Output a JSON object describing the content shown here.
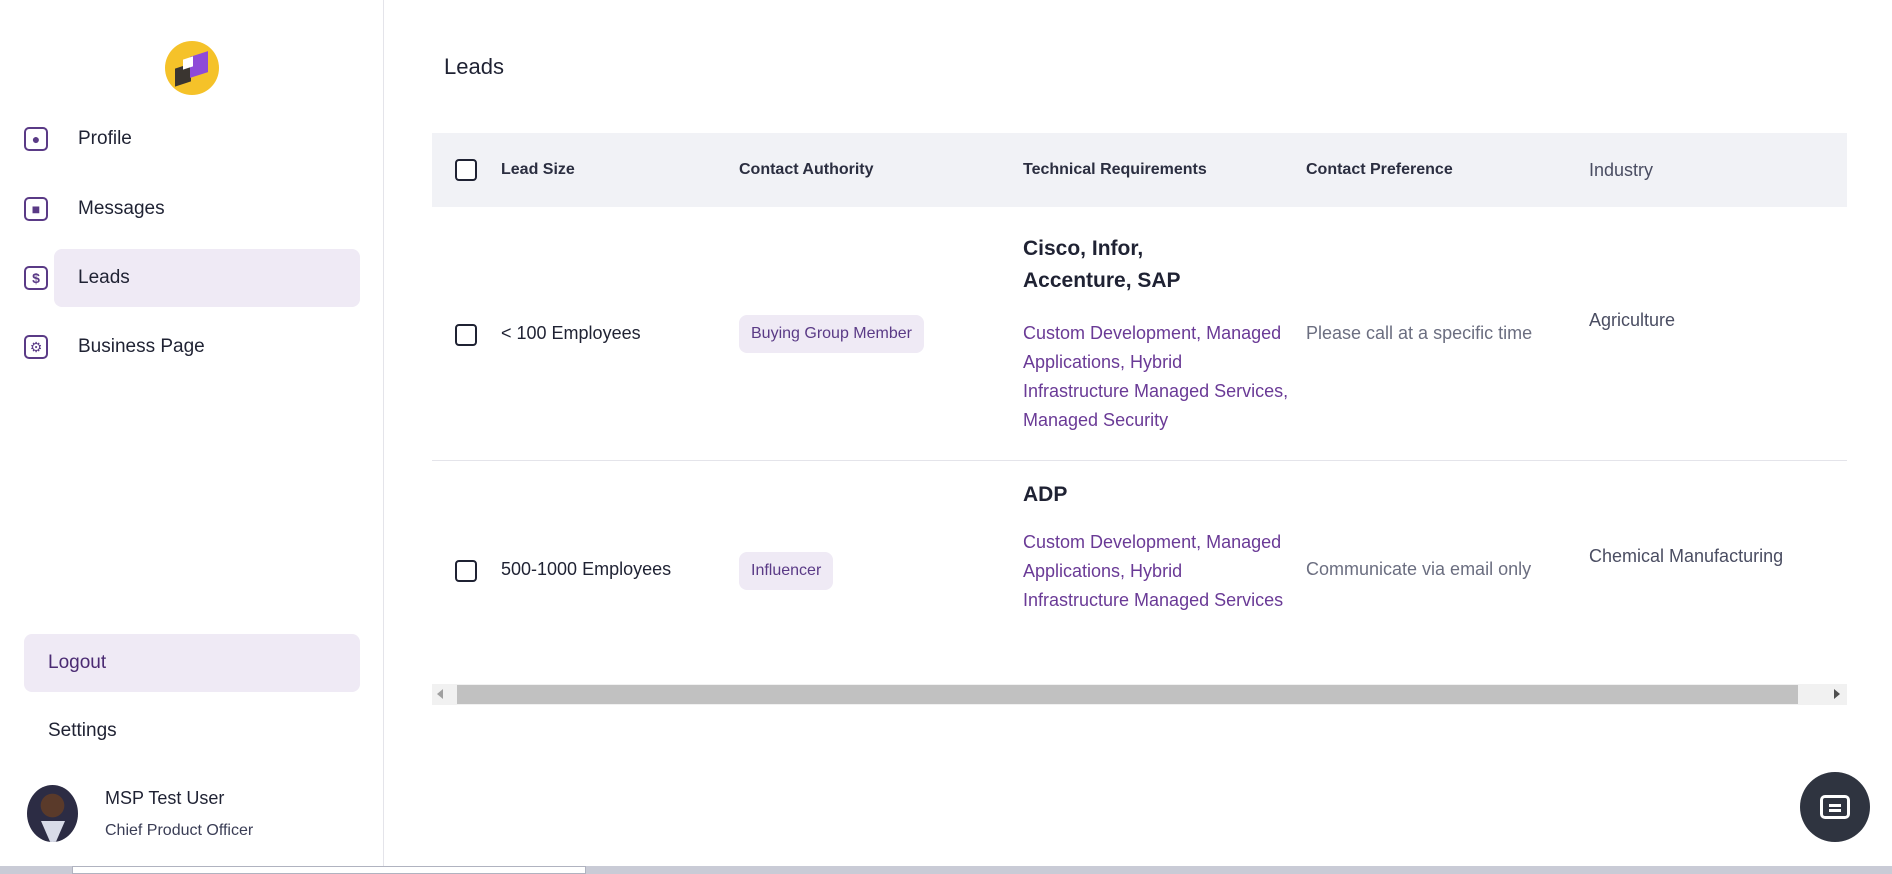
{
  "sidebar": {
    "nav": [
      {
        "label": "Profile",
        "icon": "person-icon"
      },
      {
        "label": "Messages",
        "icon": "chat-icon"
      },
      {
        "label": "Leads",
        "icon": "dollar-icon"
      },
      {
        "label": "Business Page",
        "icon": "gear-icon"
      }
    ],
    "logout_label": "Logout",
    "settings_label": "Settings",
    "user": {
      "name": "MSP Test User",
      "role": "Chief Product Officer"
    }
  },
  "main": {
    "title": "Leads",
    "table": {
      "headers": {
        "lead_size": "Lead Size",
        "contact_authority": "Contact Authority",
        "technical_requirements": "Technical Requirements",
        "contact_preference": "Contact Preference",
        "industry": "Industry"
      },
      "rows": [
        {
          "lead_size": "< 100 Employees",
          "contact_authority": "Buying Group Member",
          "tech_title": "Cisco, Infor, Accenture, SAP",
          "tech_list": "Custom Development, Managed Applications, Hybrid Infrastructure Managed Services, Managed Security",
          "contact_preference": "Please call at a specific time",
          "industry": "Agriculture"
        },
        {
          "lead_size": "500-1000 Employees",
          "contact_authority": "Influencer",
          "tech_title": "ADP",
          "tech_list": "Custom Development, Managed Applications, Hybrid Infrastructure Managed Services",
          "contact_preference": "Communicate via email only",
          "industry": "Chemical Manufacturing"
        }
      ]
    }
  },
  "colors": {
    "accent": "#5a3a86",
    "active_bg": "#efeaf5",
    "logo": "#f5c229"
  }
}
